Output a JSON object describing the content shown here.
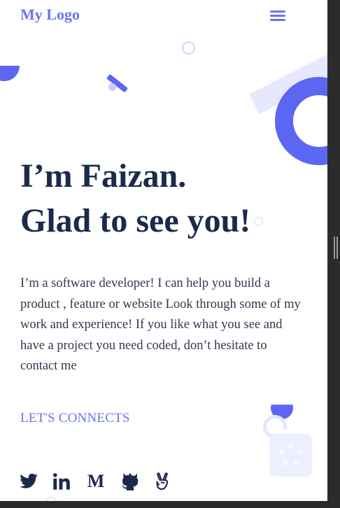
{
  "header": {
    "logo_text": "My Logo",
    "menu_icon": "hamburger-menu-icon"
  },
  "hero": {
    "title_line_1": "I’m Faizan.",
    "title_line_2": "Glad to see you!",
    "intro": "I’m a software developer! I can help you build a product , feature or website Look through some of my work and experience! If you like what you see and have a project you need coded, don’t hesitate to contact me",
    "connect_label": "LET'S CONNECTS"
  },
  "social": {
    "icons": [
      "twitter-icon",
      "linkedin-icon",
      "medium-icon",
      "github-icon",
      "angellist-icon"
    ],
    "medium_glyph": "M"
  },
  "colors": {
    "accent": "#6b74f0",
    "shape_blue": "#5b66f2",
    "heading": "#1b2a4a",
    "body_text": "#2f3a4f",
    "background": "#ffffff"
  }
}
